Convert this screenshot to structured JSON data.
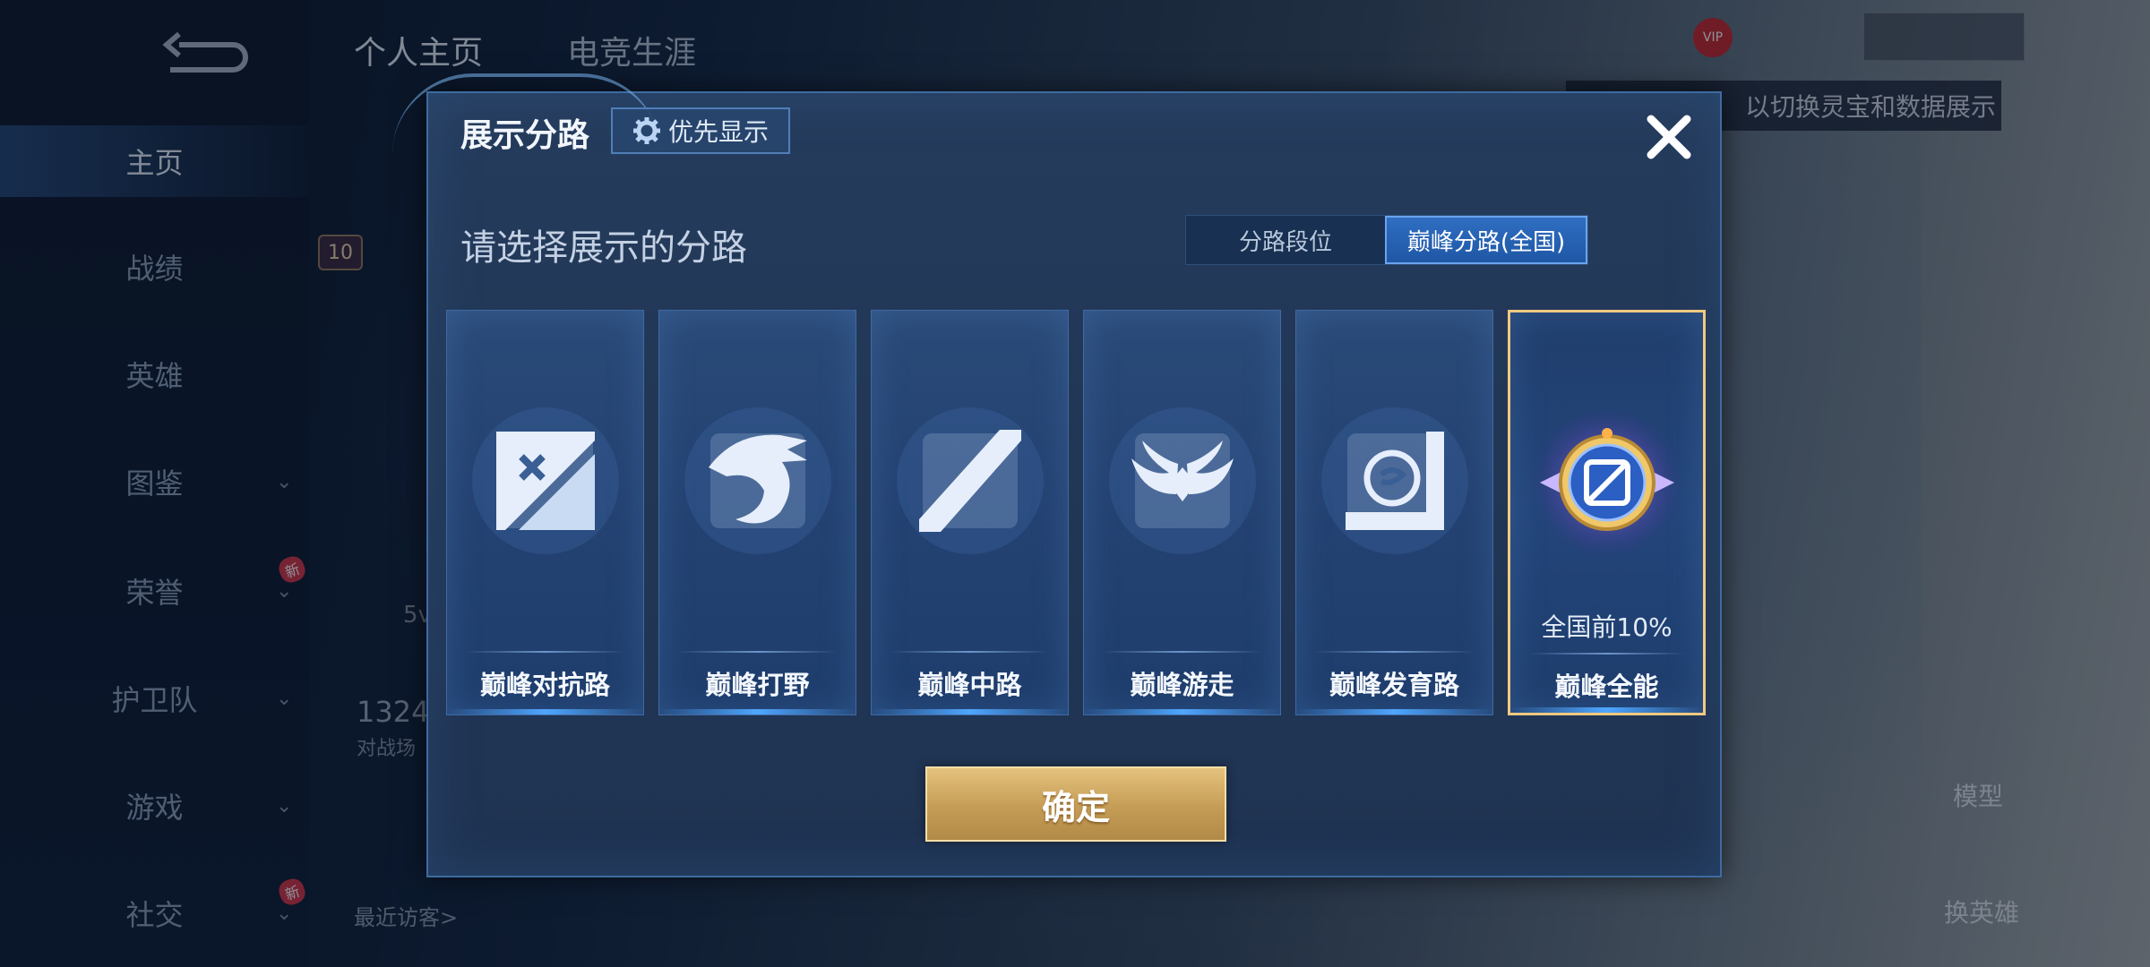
{
  "background": {
    "sidebar": {
      "items": [
        {
          "label": "主页",
          "active": true
        },
        {
          "label": "战绩"
        },
        {
          "label": "英雄"
        },
        {
          "label": "图鉴",
          "chevron": true
        },
        {
          "label": "荣誉",
          "chevron": true,
          "badge": "新"
        },
        {
          "label": "护卫队",
          "chevron": true
        },
        {
          "label": "游戏",
          "chevron": true
        },
        {
          "label": "社交",
          "chevron": true,
          "badge": "新"
        }
      ]
    },
    "tabs": [
      "个人主页",
      "电竞生涯"
    ],
    "tip_text": "以切换灵宝和数据展示",
    "level": "10",
    "count": "1324",
    "count_label": "对战场",
    "wins_partial": "5v",
    "visitors_label": "最近访客>",
    "model_label": "模型",
    "switch_hero_label": "换英雄",
    "vip_label": "VIP"
  },
  "modal": {
    "title": "展示分路",
    "priority_button": "优先显示",
    "prompt": "请选择展示的分路",
    "toggle": {
      "options": [
        "分路段位",
        "巅峰分路(全国)"
      ],
      "selected_index": 1
    },
    "cards": [
      {
        "label": "巅峰对抗路",
        "icon": "sword-cross-icon"
      },
      {
        "label": "巅峰打野",
        "icon": "dragon-icon"
      },
      {
        "label": "巅峰中路",
        "icon": "mid-lane-slash-icon"
      },
      {
        "label": "巅峰游走",
        "icon": "wings-icon"
      },
      {
        "label": "巅峰发育路",
        "icon": "marksman-icon"
      },
      {
        "label": "巅峰全能",
        "icon": "all-round-emblem-icon",
        "rank": "全国前10%",
        "selected": true
      }
    ],
    "confirm_button": "确定"
  },
  "colors": {
    "accent_blue": "#2f6ec2",
    "gold": "#c59c55",
    "selected_border": "#f2c980"
  }
}
